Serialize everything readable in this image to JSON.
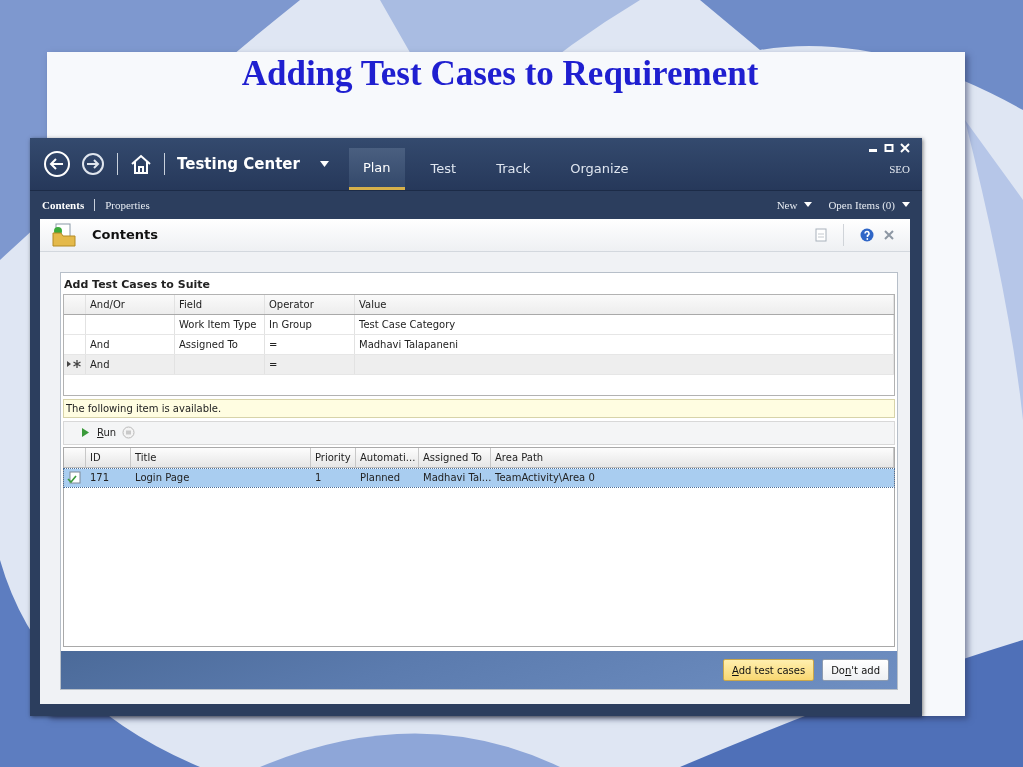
{
  "slide": {
    "title": "Adding Test Cases to Requirement"
  },
  "window": {
    "app_title": "Testing Center",
    "user": "SEO",
    "tabs": [
      {
        "label": "Plan",
        "selected": true
      },
      {
        "label": "Test",
        "selected": false
      },
      {
        "label": "Track",
        "selected": false
      },
      {
        "label": "Organize",
        "selected": false
      }
    ],
    "subnav": [
      {
        "label": "Contents",
        "selected": true
      },
      {
        "label": "Properties",
        "selected": false
      }
    ],
    "menus": [
      "New",
      "Open Items (0)"
    ]
  },
  "panel": {
    "title": "Contents"
  },
  "dialog": {
    "title": "Add Test Cases to Suite",
    "query": {
      "columns": [
        "And/Or",
        "Field",
        "Operator",
        "Value"
      ],
      "rows": [
        {
          "new_row": false,
          "field": "Work Item Type",
          "operator": "In Group",
          "value": "Test Case Category"
        },
        {
          "new_row": false,
          "and_or": "And",
          "field": "Assigned To",
          "operator": "=",
          "value": "Madhavi Talapaneni"
        },
        {
          "new_row": true,
          "and_or": "And",
          "operator": "="
        }
      ]
    },
    "info": "The following item is available.",
    "run": {
      "key": "R",
      "after": "un"
    },
    "results": {
      "columns": [
        "ID",
        "Title",
        "Priority",
        "Automati...",
        "Assigned To",
        "Area Path"
      ],
      "rows": [
        {
          "selected": true,
          "cells": [
            "171",
            "Login Page",
            "1",
            "Planned",
            "Madhavi Tal...",
            "TeamActivity\\Area 0"
          ]
        }
      ]
    },
    "buttons": [
      {
        "kind": "default",
        "label_parts": {
          "key": "A",
          "after": "dd test cases"
        }
      },
      {
        "kind": "normal",
        "label_parts": {
          "before": "Do",
          "key": "n",
          "after": "'t add"
        }
      }
    ]
  }
}
